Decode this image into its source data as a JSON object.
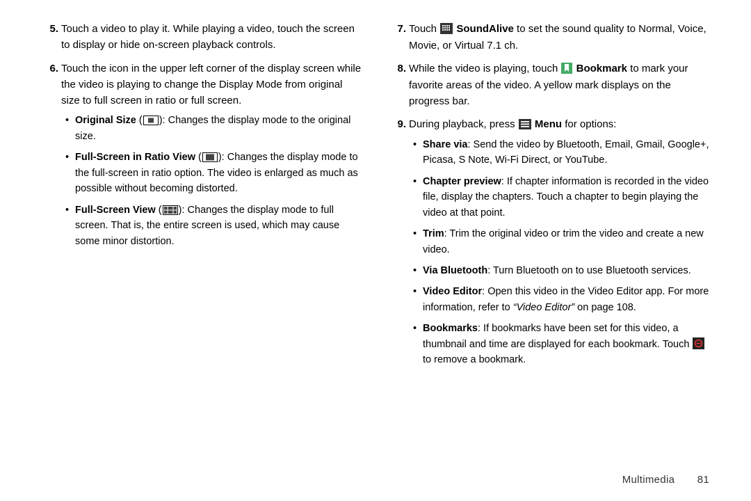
{
  "col1": {
    "item5": {
      "num": "5.",
      "text": "Touch a video to play it. While playing a video, touch the screen to display or hide on-screen playback controls."
    },
    "item6": {
      "num": "6.",
      "text": "Touch the icon in the upper left corner of the display screen while the video is playing to change the Display Mode from original size to full screen in ratio or full screen.",
      "b1": {
        "title": "Original Size",
        "rest": ": Changes the display mode to the original size."
      },
      "b2": {
        "title": "Full-Screen in Ratio View",
        "rest": ": Changes the display mode to the full-screen in ratio option. The video is enlarged as much as possible without becoming distorted."
      },
      "b3": {
        "title": "Full-Screen View",
        "rest": ": Changes the display mode to full screen. That is, the entire screen is used, which may cause some minor distortion."
      }
    }
  },
  "col2": {
    "item7": {
      "num": "7.",
      "pre": "Touch ",
      "label": " SoundAlive",
      "post": " to set the sound quality to Normal, Voice, Movie, or Virtual 7.1 ch."
    },
    "item8": {
      "num": "8.",
      "pre": "While the video is playing, touch ",
      "label": " Bookmark",
      "post": " to mark your favorite areas of the video. A yellow mark displays on the progress bar."
    },
    "item9": {
      "num": "9.",
      "pre": "During playback, press ",
      "label": " Menu",
      "post": " for options:",
      "b1": {
        "title": "Share via",
        "rest": ": Send the video by Bluetooth, Email, Gmail, Google+, Picasa, S Note, Wi-Fi Direct, or YouTube."
      },
      "b2": {
        "title": "Chapter preview",
        "rest": ": If chapter information is recorded in the video file, display the chapters. Touch a chapter to begin playing the video at that point."
      },
      "b3": {
        "title": "Trim",
        "rest": ": Trim the original video or trim the video and create a new video."
      },
      "b4": {
        "title": "Via Bluetooth",
        "rest": ": Turn Bluetooth on to use Bluetooth services."
      },
      "b5": {
        "title": "Video Editor",
        "rest1": ": Open this video in the Video Editor app. For more information, refer to ",
        "link": "“Video Editor”",
        "rest2": "  on page 108."
      },
      "b6": {
        "title": "Bookmarks",
        "rest": ": If bookmarks have been set for this video, a thumbnail and time are displayed for each bookmark. Touch ",
        "tail": " to remove a bookmark."
      }
    }
  },
  "footer": {
    "chapter": "Multimedia",
    "page": "81"
  }
}
